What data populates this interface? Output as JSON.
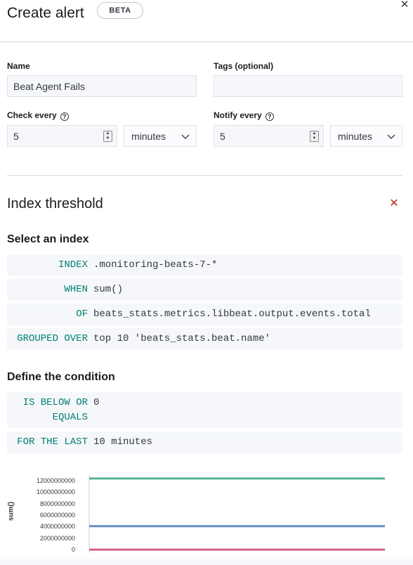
{
  "header": {
    "title": "Create alert",
    "badge": "BETA",
    "close_icon": "close-icon"
  },
  "form": {
    "name_label": "Name",
    "name_value": "Beat Agent Fails",
    "tags_label": "Tags (optional)",
    "tags_value": "",
    "check_every_label": "Check every",
    "check_every_value": "5",
    "check_every_unit": "minutes",
    "notify_every_label": "Notify every",
    "notify_every_value": "5",
    "notify_every_unit": "minutes",
    "help_glyph": "?"
  },
  "threshold": {
    "title": "Index threshold",
    "select_index_heading": "Select an index",
    "rows": [
      {
        "kw": "INDEX",
        "val": ".monitoring-beats-7-*"
      },
      {
        "kw": "WHEN",
        "val": "sum()"
      },
      {
        "kw": "OF",
        "val": "beats_stats.metrics.libbeat.output.events.total"
      },
      {
        "kw": "GROUPED OVER",
        "val": "top 10 'beats_stats.beat.name'"
      }
    ],
    "condition_heading": "Define the condition",
    "condition_kw_line1": "IS BELOW OR",
    "condition_kw_line2": "EQUALS",
    "condition_val": "0",
    "for_the_last_kw": "FOR THE LAST",
    "for_the_last_val": "10 minutes"
  },
  "chart_data": {
    "type": "line",
    "ylabel": "sum()",
    "ylim": [
      0,
      13000000000
    ],
    "yticks": [
      "12000000000",
      "10000000000",
      "8000000000",
      "6000000000",
      "4000000000",
      "2000000000",
      "0"
    ],
    "series": [
      {
        "color": "#54b399",
        "values": [
          12500000000,
          12500000000,
          12500000000,
          12500000000,
          12500000000
        ]
      },
      {
        "color": "#6092c0",
        "values": [
          4200000000,
          4200000000,
          4200000000,
          4200000000,
          4200000000
        ]
      },
      {
        "color": "#d36086",
        "values": [
          100000000,
          100000000,
          100000000,
          100000000,
          100000000
        ]
      }
    ]
  }
}
